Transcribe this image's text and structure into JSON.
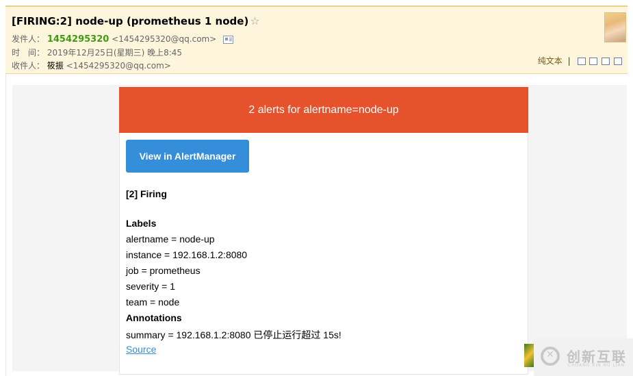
{
  "email": {
    "subject": "[FIRING:2] node-up (prometheus 1 node)",
    "star_icon": "star-outline-icon",
    "sender_label": "发件人：",
    "sender_name": "1454295320",
    "sender_address": "<1454295320@qq.com>",
    "time_label": "时　间：",
    "time_value": "2019年12月25日(星期三) 晚上8:45",
    "recipient_label": "收件人：",
    "recipient_name": "筱振",
    "recipient_address": "<1454295320@qq.com>"
  },
  "toolbar": {
    "plain_text_label": "纯文本",
    "separator": "|",
    "icons": [
      "new-window-icon",
      "print-preview-icon",
      "download-icon",
      "print-icon"
    ]
  },
  "alert": {
    "banner_title": "2 alerts for alertname=node-up",
    "view_button": "View in AlertManager",
    "firing_heading": "[2] Firing",
    "labels_heading": "Labels",
    "labels": [
      "alertname = node-up",
      "instance = 192.168.1.2:8080",
      "job = prometheus",
      "severity = 1",
      "team = node"
    ],
    "annotations_heading": "Annotations",
    "summary": "summary = 192.168.1.2:8080 已停止运行超过 15s!",
    "source_link": "Source"
  },
  "colors": {
    "banner": "#e6522c",
    "button": "#348eda",
    "header_bg": "#fdf5dc",
    "sender_name": "#3f9a12"
  },
  "watermark": {
    "text": "创新互联",
    "sub": "CHUANG XIN HU LIAN"
  }
}
